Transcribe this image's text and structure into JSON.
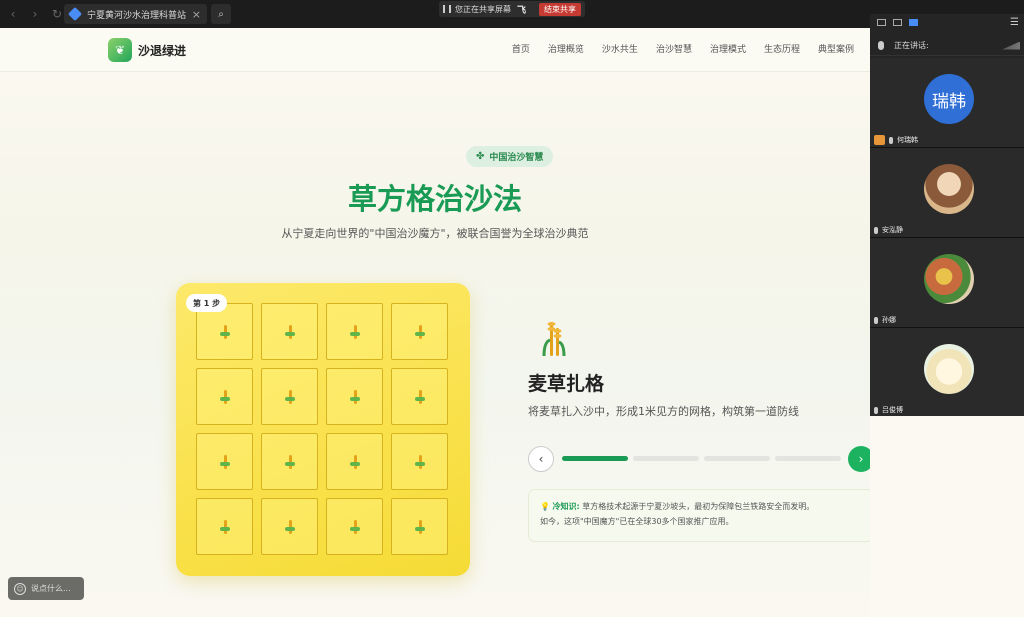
{
  "browser": {
    "tab_title": "宁夏黄河沙水治理科普站",
    "share_banner_text": "您正在共享屏幕",
    "share_logo": "飞",
    "share_end_label": "结束共享"
  },
  "site": {
    "logo_text": "沙退绿进",
    "nav": [
      "首页",
      "治理概览",
      "沙水共生",
      "治沙智慧",
      "治理模式",
      "生态历程",
      "典型案例"
    ]
  },
  "hero": {
    "badge": "中国治沙智慧",
    "title": "草方格治沙法",
    "subtitle": "从宁夏走向世界的\"中国治沙魔方\"，被联合国誉为全球治沙典范"
  },
  "demo": {
    "step_badge": "第 1 步",
    "grid_rows": 4,
    "grid_cols": 4
  },
  "step": {
    "title": "麦草扎格",
    "description": "将麦草扎入沙中，形成1米见方的网格，构筑第一道防线",
    "progress_total": 4,
    "progress_current": 1
  },
  "fact": {
    "label": "冷知识:",
    "line1": "草方格技术起源于宁夏沙坡头，最初为保障包兰铁路安全而发明。",
    "line2": "如今，这项\"中国魔方\"已在全球30多个国家推广应用。"
  },
  "chat_input": {
    "placeholder": "说点什么..."
  },
  "meeting": {
    "speaking_label": "正在讲话:",
    "participants": [
      {
        "name": "何瑞韩",
        "avatar_text": "瑞韩",
        "avatar_color": "#2f6fd6",
        "host": true
      },
      {
        "name": "安泓静",
        "avatar_text": "",
        "avatar_color": "#b8916a",
        "host": false
      },
      {
        "name": "孙娜",
        "avatar_text": "",
        "avatar_color": "#c76b3e",
        "host": false
      },
      {
        "name": "吕俊博",
        "avatar_text": "",
        "avatar_color": "#f3efd8",
        "host": false
      }
    ]
  },
  "colors": {
    "accent": "#1a9b55",
    "grid_panel": "#f6db35",
    "share_end": "#c53a32"
  }
}
